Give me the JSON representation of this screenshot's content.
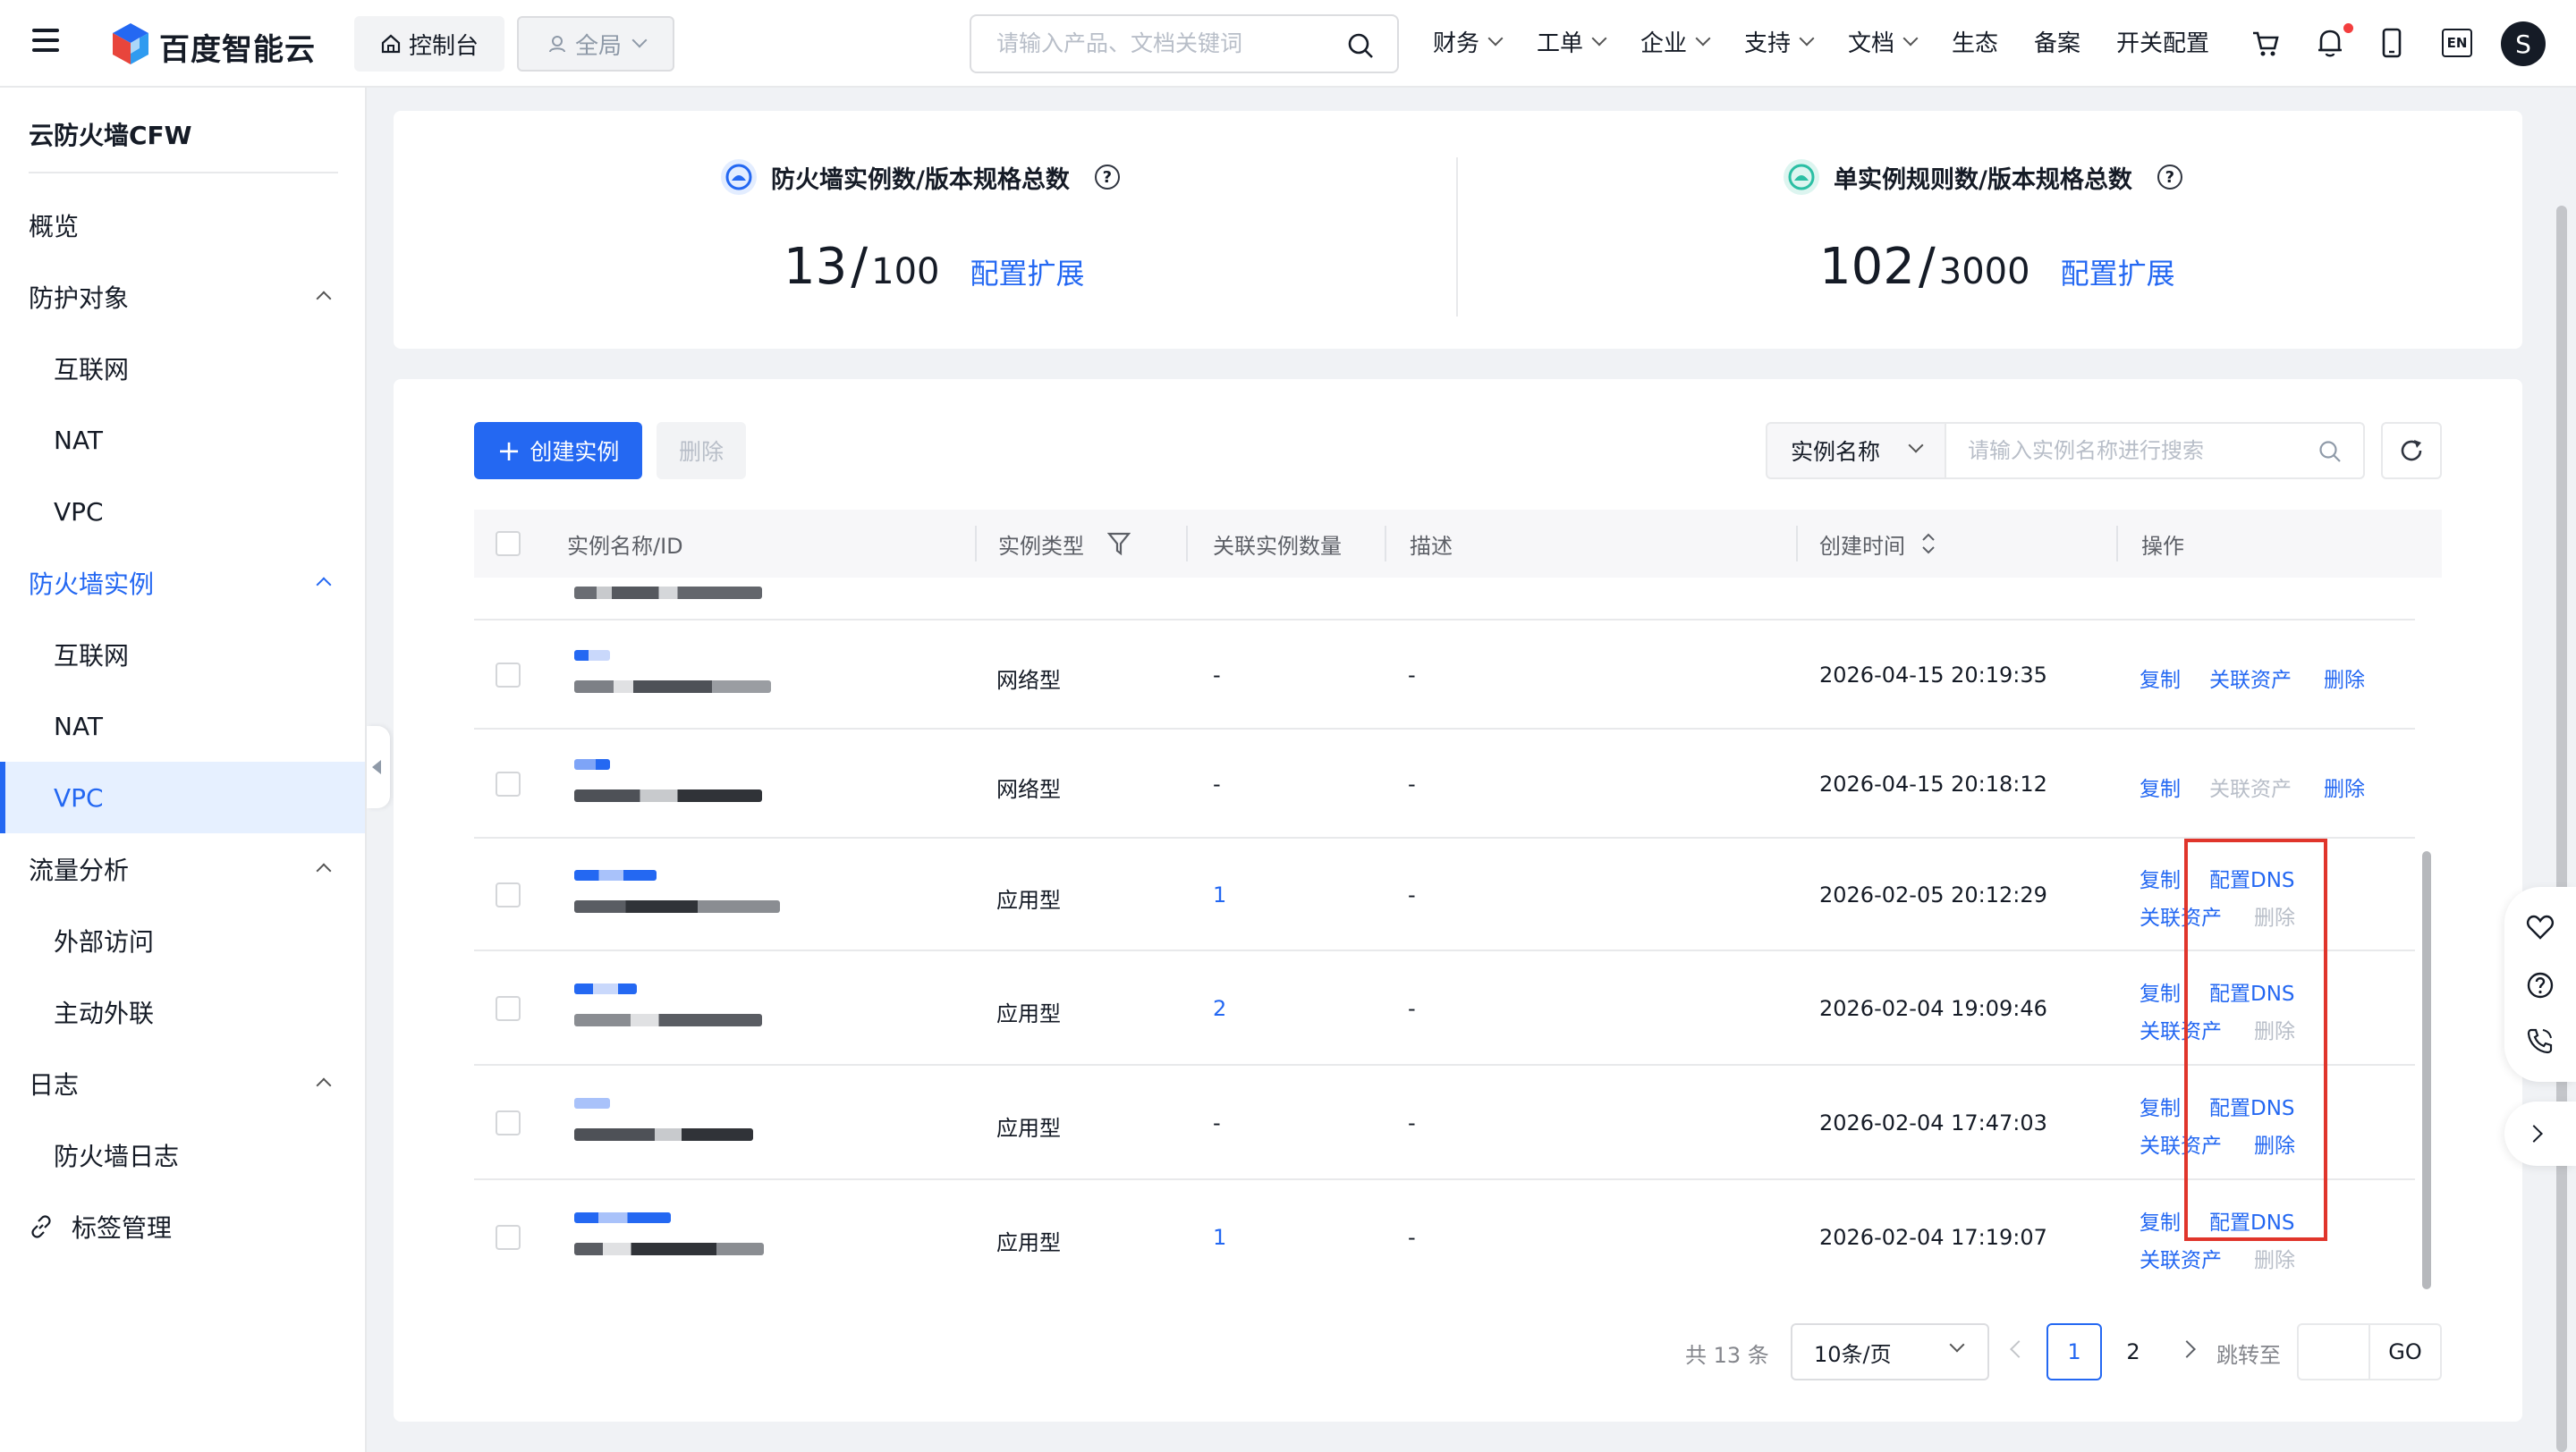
{
  "topbar": {
    "logo_text": "百度智能云",
    "console_label": "控制台",
    "region_label": "全局",
    "search_placeholder": "请输入产品、文档关键词",
    "nav": [
      "财务",
      "工单",
      "企业",
      "支持",
      "文档",
      "生态",
      "备案",
      "开关配置"
    ],
    "nav_dropdown": [
      true,
      true,
      true,
      true,
      true,
      false,
      false,
      false
    ],
    "lang_label": "EN",
    "avatar_letter": "S"
  },
  "sidebar": {
    "title": "云防火墙CFW",
    "items": [
      {
        "label": "概览",
        "level": 1
      },
      {
        "label": "防护对象",
        "level": 1,
        "expanded": true
      },
      {
        "label": "互联网",
        "level": 2
      },
      {
        "label": "NAT",
        "level": 2
      },
      {
        "label": "VPC",
        "level": 2
      },
      {
        "label": "防火墙实例",
        "level": 1,
        "expanded": true,
        "group_active": true
      },
      {
        "label": "互联网",
        "level": 2
      },
      {
        "label": "NAT",
        "level": 2
      },
      {
        "label": "VPC",
        "level": 2,
        "active": true
      },
      {
        "label": "流量分析",
        "level": 1,
        "expanded": true
      },
      {
        "label": "外部访问",
        "level": 2
      },
      {
        "label": "主动外联",
        "level": 2
      },
      {
        "label": "日志",
        "level": 1,
        "expanded": true
      },
      {
        "label": "防火墙日志",
        "level": 2
      },
      {
        "label": "标签管理",
        "level": 1,
        "icon": "link-icon"
      }
    ]
  },
  "stats": {
    "instances": {
      "title": "防火墙实例数/版本规格总数",
      "used": "13",
      "sep": "/",
      "total": "100",
      "action": "配置扩展"
    },
    "rules": {
      "title": "单实例规则数/版本规格总数",
      "used": "102",
      "sep": "/",
      "total": "3000",
      "action": "配置扩展"
    }
  },
  "toolbar": {
    "create_label": "创建实例",
    "delete_label": "删除",
    "filter_field": "实例名称",
    "filter_placeholder": "请输入实例名称进行搜索"
  },
  "table": {
    "columns": [
      "实例名称/ID",
      "实例类型",
      "关联实例数量",
      "描述",
      "创建时间",
      "操作"
    ],
    "rows": [
      {
        "type": "网络型",
        "count": "-",
        "count_link": false,
        "desc": "-",
        "created": "2026-04-15 20:19:35",
        "layout": "single",
        "actions": [
          {
            "label": "复制",
            "enabled": true
          },
          {
            "label": "关联资产",
            "enabled": true
          },
          {
            "label": "删除",
            "enabled": true
          }
        ]
      },
      {
        "type": "网络型",
        "count": "-",
        "count_link": false,
        "desc": "-",
        "created": "2026-04-15 20:18:12",
        "layout": "single",
        "actions": [
          {
            "label": "复制",
            "enabled": true
          },
          {
            "label": "关联资产",
            "enabled": false
          },
          {
            "label": "删除",
            "enabled": true
          }
        ]
      },
      {
        "type": "应用型",
        "count": "1",
        "count_link": true,
        "desc": "-",
        "created": "2026-02-05 20:12:29",
        "layout": "double",
        "actions": [
          {
            "label": "复制",
            "enabled": true
          },
          {
            "label": "配置DNS",
            "enabled": true
          },
          {
            "label": "关联资产",
            "enabled": true
          },
          {
            "label": "删除",
            "enabled": false
          }
        ]
      },
      {
        "type": "应用型",
        "count": "2",
        "count_link": true,
        "desc": "-",
        "created": "2026-02-04 19:09:46",
        "layout": "double",
        "actions": [
          {
            "label": "复制",
            "enabled": true
          },
          {
            "label": "配置DNS",
            "enabled": true
          },
          {
            "label": "关联资产",
            "enabled": true
          },
          {
            "label": "删除",
            "enabled": false
          }
        ]
      },
      {
        "type": "应用型",
        "count": "-",
        "count_link": false,
        "desc": "-",
        "created": "2026-02-04 17:47:03",
        "layout": "double",
        "actions": [
          {
            "label": "复制",
            "enabled": true
          },
          {
            "label": "配置DNS",
            "enabled": true
          },
          {
            "label": "关联资产",
            "enabled": true
          },
          {
            "label": "删除",
            "enabled": true
          }
        ]
      },
      {
        "type": "应用型",
        "count": "1",
        "count_link": true,
        "desc": "-",
        "created": "2026-02-04 17:19:07",
        "layout": "double",
        "actions": [
          {
            "label": "复制",
            "enabled": true
          },
          {
            "label": "配置DNS",
            "enabled": true
          },
          {
            "label": "关联资产",
            "enabled": true
          },
          {
            "label": "删除",
            "enabled": false
          }
        ]
      }
    ]
  },
  "pagination": {
    "total_text": "共 13 条",
    "page_size": "10条/页",
    "pages": [
      "1",
      "2"
    ],
    "current": "1",
    "jump_label": "跳转至",
    "go_label": "GO"
  },
  "colors": {
    "accent": "#2468f2",
    "highlight_box": "#e0352b",
    "disabled": "#b8bec8"
  }
}
